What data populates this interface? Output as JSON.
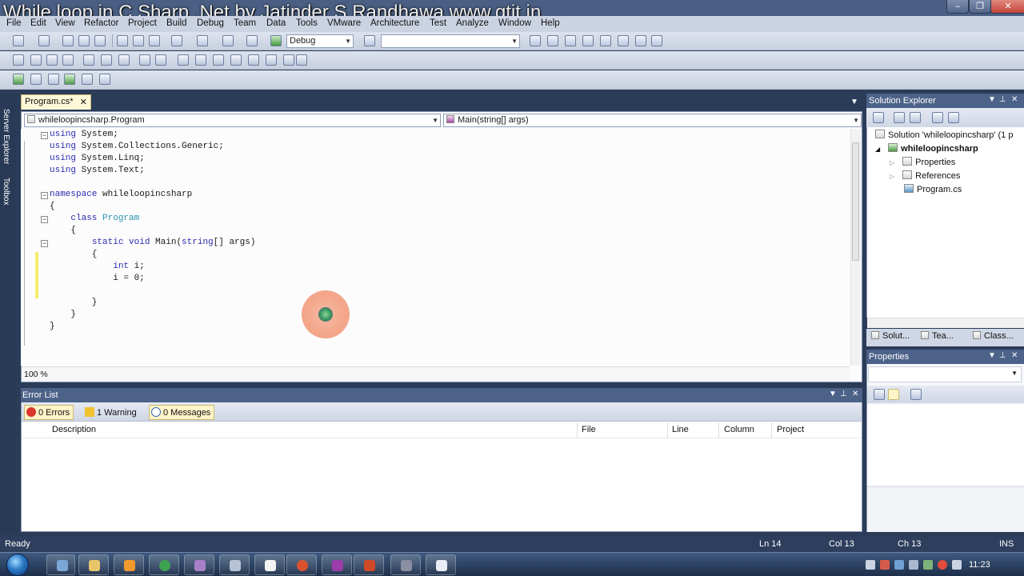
{
  "window": {
    "title": "While loop in C Sharp .Net by Jatinder S Randhawa www.gtit.in"
  },
  "menu": [
    "File",
    "Edit",
    "View",
    "Refactor",
    "Project",
    "Build",
    "Debug",
    "Team",
    "Data",
    "Tools",
    "VMware",
    "Architecture",
    "Test",
    "Analyze",
    "Window",
    "Help"
  ],
  "toolbar": {
    "config_value": "Debug",
    "find_value": ""
  },
  "left_strip": {
    "server_explorer": "Server Explorer",
    "toolbox": "Toolbox"
  },
  "editor": {
    "tab_label": "Program.cs*",
    "nav_class": "whileloopincsharp.Program",
    "nav_member": "Main(string[] args)",
    "zoom": "100 %",
    "code_lines": [
      "using System;",
      "using System.Collections.Generic;",
      "using System.Linq;",
      "using System.Text;",
      "",
      "namespace whileloopincsharp",
      "{",
      "    class Program",
      "    {",
      "        static void Main(string[] args)",
      "        {",
      "            int i;",
      "            i = 0;",
      "",
      "        }",
      "    }",
      "}"
    ]
  },
  "error_list": {
    "title": "Error List",
    "errors_label": "0 Errors",
    "warnings_label": "1 Warning",
    "messages_label": "0 Messages",
    "columns": [
      "Description",
      "File",
      "Line",
      "Column",
      "Project"
    ]
  },
  "solution_explorer": {
    "title": "Solution Explorer",
    "solution": "Solution 'whileloopincsharp' (1 p",
    "project": "whileloopincsharp",
    "items": [
      "Properties",
      "References",
      "Program.cs"
    ],
    "tabs": [
      "Solut...",
      "Tea...",
      "Class..."
    ]
  },
  "properties": {
    "title": "Properties"
  },
  "status": {
    "left": "Ready",
    "ln": "Ln 14",
    "col": "Col 13",
    "ch": "Ch 13",
    "mode": "INS"
  },
  "taskbar": {
    "clock": "11:23"
  },
  "colors": {
    "chrome_dark": "#2b3c59",
    "panel_header": "#4c6288",
    "keyword": "#2a2ab0",
    "type": "#2b91af",
    "active_tab": "#fff8d8"
  }
}
